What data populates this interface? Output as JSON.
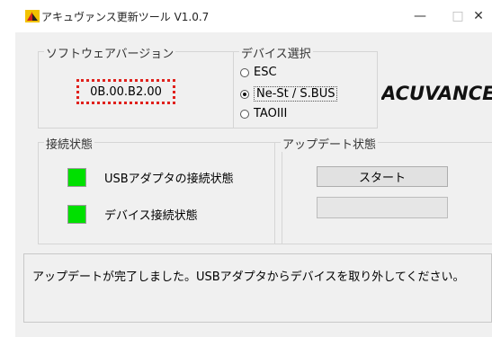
{
  "titlebar": {
    "title": "アキュヴァンス更新ツール V1.0.7",
    "controls": {
      "minimize": "—",
      "maximize": "□",
      "close": "✕"
    }
  },
  "software_version": {
    "label": "ソフトウェアバージョン",
    "value": "0B.00.B2.00"
  },
  "device_select": {
    "label": "デバイス選択",
    "options": [
      {
        "label": "ESC",
        "selected": false
      },
      {
        "label": "Ne-St / S.BUS",
        "selected": true
      },
      {
        "label": "TAOIII",
        "selected": false
      }
    ]
  },
  "logo": {
    "text": "ACUVANCE",
    "icon": "acuvance-logo",
    "color": "#111111"
  },
  "connection_status": {
    "label": "接続状態",
    "items": [
      {
        "label": "USBアダプタの接続状態",
        "color": "#00e000"
      },
      {
        "label": "デバイス接続状態",
        "color": "#00e000"
      }
    ]
  },
  "update_status": {
    "label": "アップデート状態",
    "start_label": "スタート",
    "progress": 0
  },
  "message": "アップデートが完了しました。USBアダプタからデバイスを取り外してください。",
  "colors": {
    "accent_highlight": "#e0201c",
    "window_bg": "#f0f0f0"
  }
}
